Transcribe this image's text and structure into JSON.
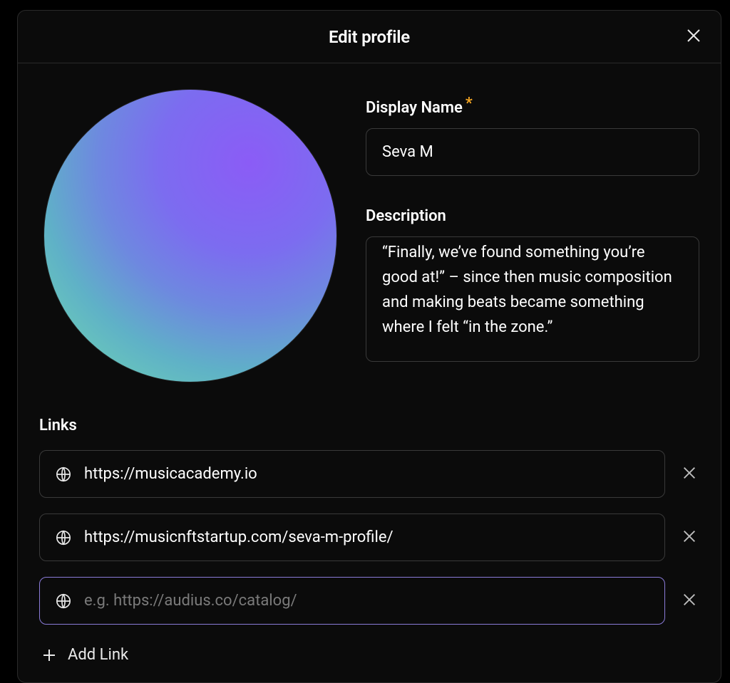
{
  "modal": {
    "title": "Edit profile"
  },
  "display_name": {
    "label": "Display Name",
    "required_mark": "*",
    "value": "Seva M"
  },
  "description": {
    "label": "Description",
    "value": "“Finally, we’ve found something you’re good at!” – since then music composition and making beats became something where I felt “in the zone.”"
  },
  "links": {
    "label": "Links",
    "items": [
      {
        "value": "https://musicacademy.io",
        "placeholder": "",
        "focused": false
      },
      {
        "value": "https://musicnftstartup.com/seva-m-profile/",
        "placeholder": "",
        "focused": false
      },
      {
        "value": "",
        "placeholder": "e.g. https://audius.co/catalog/",
        "focused": true
      }
    ],
    "add_label": "Add Link"
  }
}
